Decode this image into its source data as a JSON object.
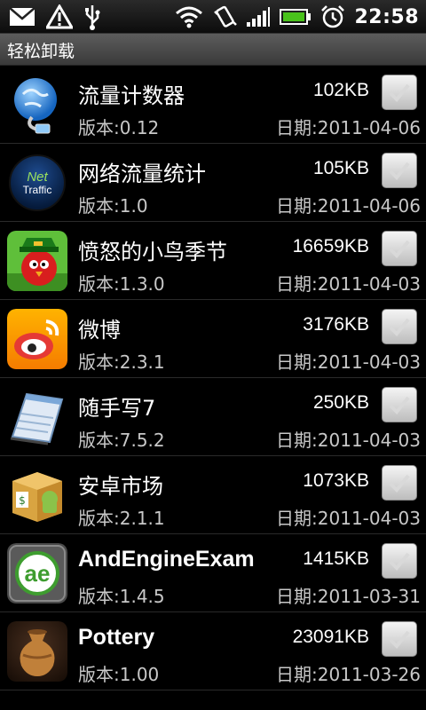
{
  "status_bar": {
    "time": "22:58",
    "icons": [
      "mail-icon",
      "warning-icon",
      "usb-icon",
      "wifi-icon",
      "vibrate-icon",
      "signal-icon",
      "battery-icon",
      "alarm-icon"
    ]
  },
  "title": "轻松卸载",
  "apps": [
    {
      "name": "流量计数器",
      "size": "102KB",
      "version": "版本:0.12",
      "date": "日期:2011-04-06",
      "checked": false,
      "icon": "globe-cable-icon"
    },
    {
      "name": "网络流量统计",
      "size": "105KB",
      "version": "版本:1.0",
      "date": "日期:2011-04-06",
      "checked": false,
      "icon": "net-traffic-icon",
      "icon_text_1": "Net",
      "icon_text_2": "Traffic"
    },
    {
      "name": "愤怒的小鸟季节",
      "size": "16659KB",
      "version": "版本:1.3.0",
      "date": "日期:2011-04-03",
      "checked": false,
      "icon": "angry-bird-icon"
    },
    {
      "name": "微博",
      "size": "3176KB",
      "version": "版本:2.3.1",
      "date": "日期:2011-04-03",
      "checked": false,
      "icon": "weibo-icon"
    },
    {
      "name": "随手写7",
      "size": "250KB",
      "version": "版本:7.5.2",
      "date": "日期:2011-04-03",
      "checked": false,
      "icon": "notepad-icon"
    },
    {
      "name": "安卓市场",
      "size": "1073KB",
      "version": "版本:2.1.1",
      "date": "日期:2011-04-03",
      "checked": false,
      "icon": "market-box-icon"
    },
    {
      "name": "AndEngineExam",
      "size": "1415KB",
      "version": "版本:1.4.5",
      "date": "日期:2011-03-31",
      "checked": false,
      "icon": "andengine-icon",
      "icon_text_1": "ae"
    },
    {
      "name": "Pottery",
      "size": "23091KB",
      "version": "版本:1.00",
      "date": "日期:2011-03-26",
      "checked": false,
      "icon": "pottery-vase-icon"
    }
  ]
}
